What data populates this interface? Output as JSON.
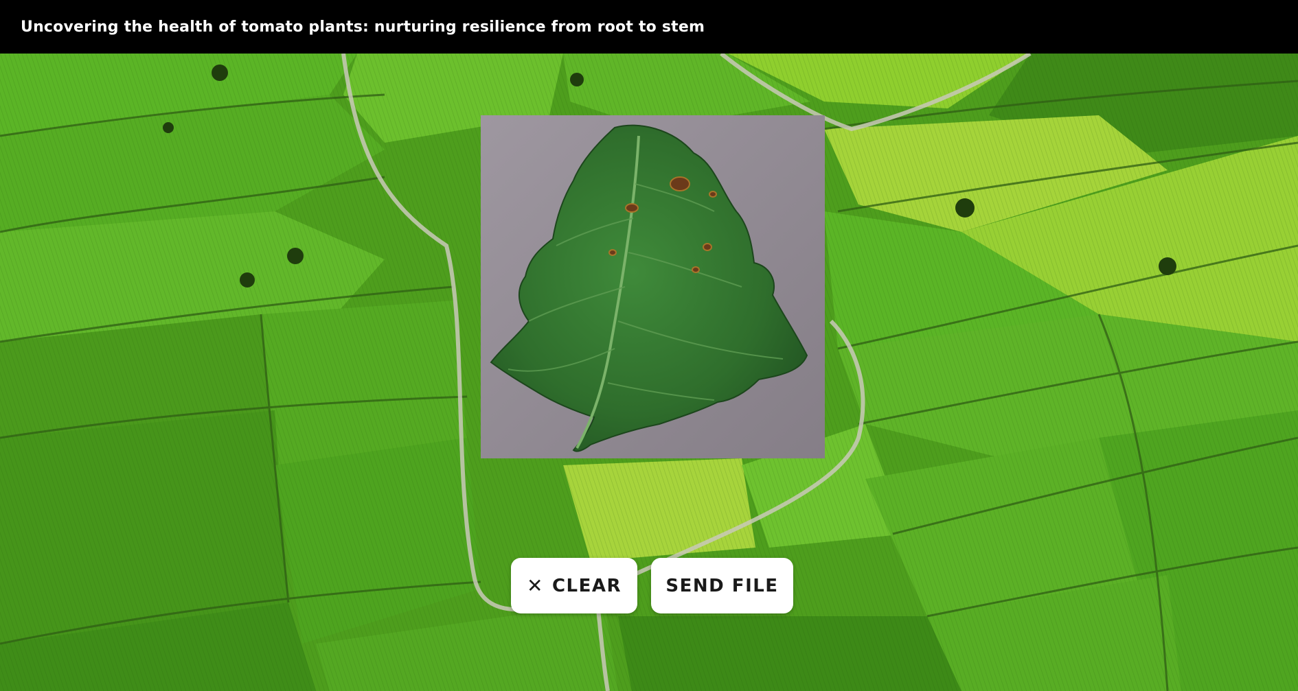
{
  "header": {
    "title": "Uncovering the health of tomato plants: nurturing resilience from root to stem"
  },
  "preview": {
    "image_subject": "tomato leaf with brown spots on grey background"
  },
  "actions": {
    "clear_label": "CLEAR",
    "clear_icon": "close-icon",
    "send_label": "SEND FILE"
  },
  "colors": {
    "header_bg": "#000000",
    "field_green": "#4fa21c",
    "button_bg": "#ffffff"
  }
}
